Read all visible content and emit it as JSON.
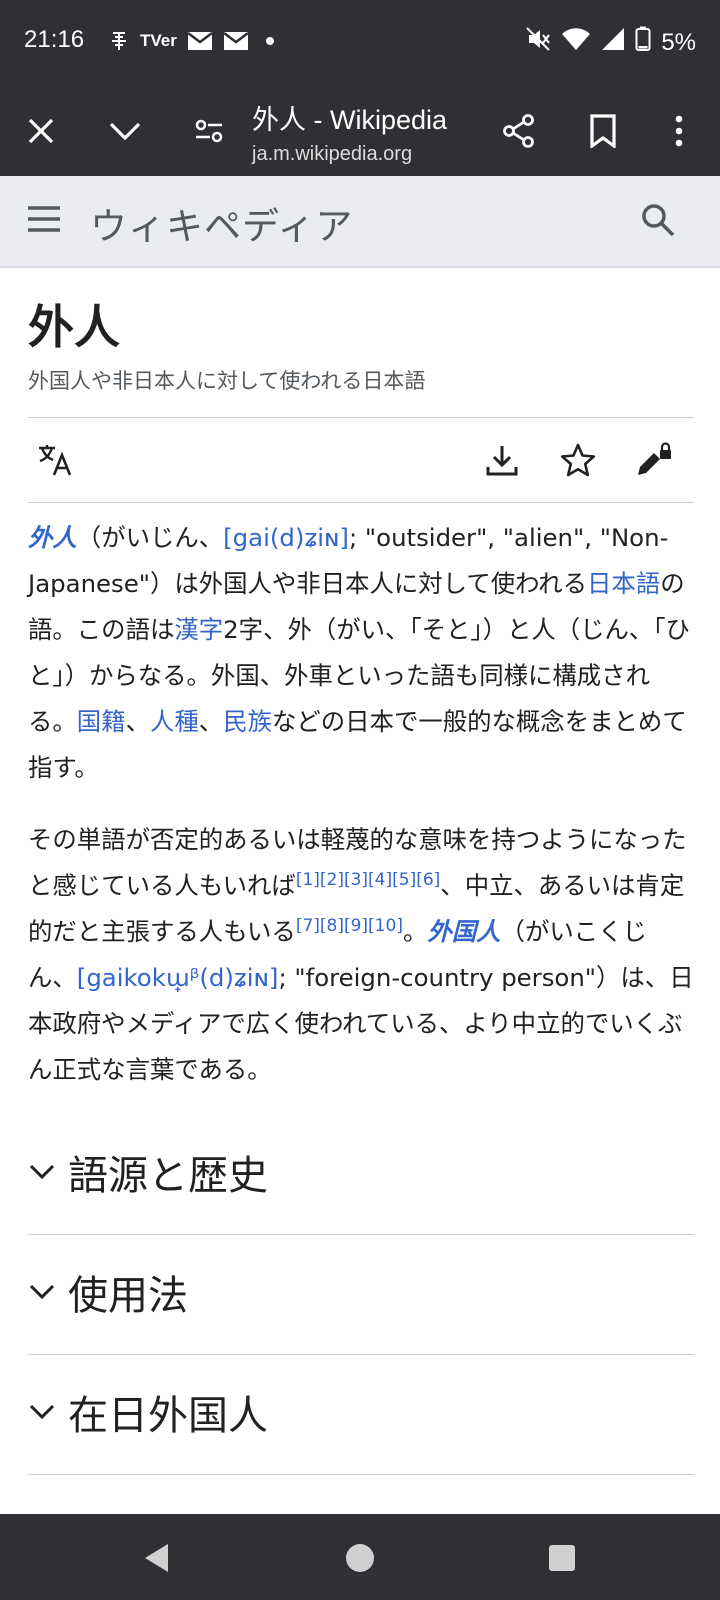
{
  "status_bar": {
    "time": "21:16",
    "notification_icons": [
      "signal-app-icon",
      "tver-icon",
      "gmail-icon",
      "gmail-icon",
      "dot-icon"
    ],
    "tver_label": "TVer",
    "battery": "5%"
  },
  "toolbar": {
    "tab_title": "外人 - Wikipedia",
    "tab_url": "ja.m.wikipedia.org"
  },
  "wiki_header": {
    "logo_text": "ウィキペディア"
  },
  "article": {
    "title": "外人",
    "tagline": "外国人や非日本人に対して使われる日本語",
    "p1": {
      "term": "外人",
      "t1": "（がいじん、",
      "ipa": "[gai(d)ʑiɴ]",
      "t2": "; \"outsider\", \"alien\", \"Non-Japanese\"）は外国人や非日本人に対して使われる",
      "link_nihongo": "日本語",
      "t3": "の語。この語は",
      "link_kanji": "漢字",
      "t4": "2字、外（がい、「そと」）と人（じん、「ひと」）からなる。外国、外車といった語も同様に構成される。",
      "link_kokuseki": "国籍",
      "sep1": "、",
      "link_jinshu": "人種",
      "sep2": "、",
      "link_minzoku": "民族",
      "t5": "などの日本で一般的な概念をまとめて指す。"
    },
    "p2": {
      "t1": "その単語が否定的あるいは軽蔑的な意味を持つようになったと感じている人もいれば",
      "refs1": "[1][2][3][4][5][6]",
      "t2": "、中立、あるいは肯定的だと主張する人もいる",
      "refs2": "[7][8][9][10]",
      "t3": "。",
      "term": "外国人",
      "t4": "（がいこくじん、",
      "ipa": "[gaikokɯ̟ᵝ(d)ʑiɴ]",
      "t5": "; \"foreign-country person\"）は、日本政府やメディアで広く使われている、より中立的でいくぶん正式な言葉である。"
    },
    "sections": [
      "語源と歴史",
      "使用法",
      "在日外国人"
    ]
  },
  "colors": {
    "link": "#3366cc",
    "chrome": "#2f3033",
    "header_bg": "#eaecf0"
  }
}
